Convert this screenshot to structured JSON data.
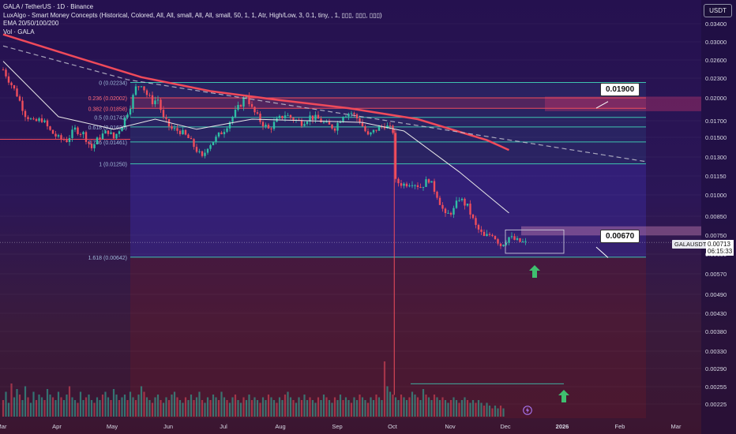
{
  "header": {
    "symbol_line": "GALA / TetherUS · 1D · Binance",
    "indicator_1": "LuxAlgo - Smart Money Concepts (Historical, Colored, All, All, small, All, All, small, 50, 1, 1, Atr, High/Low, 3, 0.1, tiny, , 1, ▯▯▯, ▯▯▯, ▯▯▯)",
    "indicator_2": "EMA 20/50/100/200",
    "indicator_3": "Vol · GALA"
  },
  "currency_button": "USDT",
  "colors": {
    "up": "#2fbfa5",
    "down": "#ef4d5c",
    "ema_slow": "#f04a5a",
    "ema_mid": "#e8e8e8",
    "fib_line": "#3fc3b0",
    "accent_arrow": "#3fbf6f"
  },
  "labels": {
    "resistance": "0.01900",
    "support": "0.00670",
    "symbol_tag": "GALAUSDT",
    "last_price": "0.00713",
    "countdown": "06:15:33"
  },
  "chart_data": {
    "type": "candlestick",
    "title": "",
    "xlabel": "",
    "ylabel": "",
    "y_scale": "log",
    "ylim": [
      0.00205,
      0.0036
    ],
    "y_ticks": [
      "0.03400",
      "0.03000",
      "0.02600",
      "0.02300",
      "0.02000",
      "0.01700",
      "0.01500",
      "0.01300",
      "0.01150",
      "0.01000",
      "0.00850",
      "0.00750",
      "0.00650",
      "0.00570",
      "0.00490",
      "0.00430",
      "0.00380",
      "0.00330",
      "0.00290",
      "0.00255",
      "0.00225"
    ],
    "x_ticks": [
      "Mar",
      "Apr",
      "May",
      "Jun",
      "Jul",
      "Aug",
      "Sep",
      "Oct",
      "Nov",
      "Dec",
      "2026",
      "Feb",
      "Mar"
    ],
    "fib_levels": [
      {
        "ratio_label": "0",
        "price": 0.02234
      },
      {
        "ratio_label": "0.236",
        "price": 0.02002
      },
      {
        "ratio_label": "0.382",
        "price": 0.01858
      },
      {
        "ratio_label": "0.5",
        "price": 0.01742
      },
      {
        "ratio_label": "0.618",
        "price": 0.01626
      },
      {
        "ratio_label": "0.786",
        "price": 0.01461
      },
      {
        "ratio_label": "1",
        "price": 0.0125
      },
      {
        "ratio_label": "1.618",
        "price": 0.00642
      }
    ],
    "fib_text": [
      "0 (0.02234)",
      "0.236 (0.02002)",
      "0.382 (0.01858)",
      "0.5 (0.01742)",
      "0.618 (0.01626)",
      "0.786 (0.01461)",
      "1 (0.01250)",
      "1.618 (0.00642)"
    ],
    "key_levels": [
      0.019,
      0.0067
    ],
    "price_path": [
      [
        0,
        0.0245
      ],
      [
        2,
        0.0228
      ],
      [
        5,
        0.0205
      ],
      [
        8,
        0.0178
      ],
      [
        11,
        0.0168
      ],
      [
        14,
        0.0172
      ],
      [
        17,
        0.0158
      ],
      [
        20,
        0.015
      ],
      [
        23,
        0.0148
      ],
      [
        26,
        0.016
      ],
      [
        29,
        0.0155
      ],
      [
        32,
        0.014
      ],
      [
        35,
        0.0152
      ],
      [
        38,
        0.0158
      ],
      [
        40,
        0.015
      ],
      [
        43,
        0.0165
      ],
      [
        46,
        0.019
      ],
      [
        48,
        0.0215
      ],
      [
        50,
        0.0222
      ],
      [
        52,
        0.0205
      ],
      [
        54,
        0.0195
      ],
      [
        56,
        0.0198
      ],
      [
        58,
        0.0172
      ],
      [
        61,
        0.016
      ],
      [
        64,
        0.0158
      ],
      [
        67,
        0.015
      ],
      [
        70,
        0.0138
      ],
      [
        72,
        0.013
      ],
      [
        74,
        0.0142
      ],
      [
        77,
        0.015
      ],
      [
        80,
        0.016
      ],
      [
        83,
        0.0175
      ],
      [
        86,
        0.0192
      ],
      [
        88,
        0.0205
      ],
      [
        90,
        0.0185
      ],
      [
        93,
        0.017
      ],
      [
        96,
        0.016
      ],
      [
        99,
        0.017
      ],
      [
        102,
        0.0178
      ],
      [
        105,
        0.0172
      ],
      [
        108,
        0.0168
      ],
      [
        111,
        0.0175
      ],
      [
        114,
        0.0172
      ],
      [
        117,
        0.0165
      ],
      [
        120,
        0.0162
      ],
      [
        123,
        0.0178
      ],
      [
        126,
        0.018
      ],
      [
        129,
        0.017
      ],
      [
        132,
        0.0152
      ],
      [
        135,
        0.016
      ],
      [
        138,
        0.0165
      ],
      [
        141,
        0.0158
      ],
      [
        142,
        0.011
      ],
      [
        145,
        0.0108
      ],
      [
        148,
        0.011
      ],
      [
        151,
        0.0106
      ],
      [
        154,
        0.0112
      ],
      [
        157,
        0.01
      ],
      [
        160,
        0.0086
      ],
      [
        163,
        0.009
      ],
      [
        165,
        0.0098
      ],
      [
        168,
        0.0092
      ],
      [
        171,
        0.008
      ],
      [
        174,
        0.0074
      ],
      [
        177,
        0.0076
      ],
      [
        180,
        0.007
      ],
      [
        183,
        0.0074
      ],
      [
        186,
        0.0072
      ],
      [
        189,
        0.0071
      ]
    ],
    "ema_slow_path": [
      [
        0,
        0.0315
      ],
      [
        25,
        0.027
      ],
      [
        50,
        0.0232
      ],
      [
        75,
        0.021
      ],
      [
        100,
        0.0197
      ],
      [
        125,
        0.0186
      ],
      [
        150,
        0.0172
      ],
      [
        175,
        0.0148
      ],
      [
        183,
        0.0138
      ]
    ],
    "ema_mid_path": [
      [
        0,
        0.026
      ],
      [
        20,
        0.0175
      ],
      [
        40,
        0.016
      ],
      [
        55,
        0.0172
      ],
      [
        70,
        0.016
      ],
      [
        90,
        0.0172
      ],
      [
        110,
        0.017
      ],
      [
        130,
        0.0168
      ],
      [
        145,
        0.0158
      ],
      [
        165,
        0.0118
      ],
      [
        183,
        0.0088
      ]
    ],
    "volume_relative": [
      0.3,
      0.45,
      0.25,
      0.6,
      0.35,
      0.5,
      0.4,
      0.3,
      0.55,
      0.35,
      0.25,
      0.45,
      0.3,
      0.4,
      0.35,
      0.3,
      0.5,
      0.4,
      0.35,
      0.3,
      0.45,
      0.35,
      0.3,
      0.4,
      0.55,
      0.35,
      0.3,
      0.25,
      0.45,
      0.3,
      0.35,
      0.4,
      0.3,
      0.25,
      0.35,
      0.3,
      0.4,
      0.45,
      0.35,
      0.3,
      0.5,
      0.4,
      0.3,
      0.35,
      0.4,
      0.3,
      0.45,
      0.35,
      0.3,
      0.4,
      0.55,
      0.45,
      0.35,
      0.3,
      0.25,
      0.35,
      0.4,
      0.3,
      0.25,
      0.35,
      0.3,
      0.4,
      0.45,
      0.35,
      0.3,
      0.25,
      0.35,
      0.3,
      0.4,
      0.3,
      0.35,
      0.45,
      0.3,
      0.25,
      0.35,
      0.3,
      0.4,
      0.35,
      0.3,
      0.45,
      0.35,
      0.3,
      0.25,
      0.35,
      0.4,
      0.3,
      0.25,
      0.35,
      0.3,
      0.4,
      0.3,
      0.35,
      0.3,
      0.25,
      0.35,
      0.3,
      0.4,
      0.35,
      0.3,
      0.25,
      0.35,
      0.3,
      0.4,
      0.45,
      0.35,
      0.3,
      0.25,
      0.35,
      0.3,
      0.4,
      0.3,
      0.35,
      0.3,
      0.25,
      0.35,
      0.3,
      0.4,
      0.35,
      0.3,
      0.25,
      0.35,
      0.3,
      0.4,
      0.3,
      0.35,
      0.3,
      0.25,
      0.35,
      0.3,
      0.4,
      0.35,
      0.3,
      0.25,
      0.35,
      0.3,
      0.4,
      0.35,
      0.3,
      1.0,
      0.55,
      0.45,
      0.4,
      0.35,
      0.3,
      0.4,
      0.35,
      0.3,
      0.35,
      0.45,
      0.4,
      0.35,
      0.3,
      0.5,
      0.4,
      0.35,
      0.3,
      0.4,
      0.35,
      0.3,
      0.35,
      0.3,
      0.25,
      0.3,
      0.35,
      0.3,
      0.25,
      0.3,
      0.35,
      0.3,
      0.25,
      0.3,
      0.25,
      0.3,
      0.25,
      0.2,
      0.25,
      0.2,
      0.15,
      0.2,
      0.15,
      0.2,
      0.15
    ]
  }
}
